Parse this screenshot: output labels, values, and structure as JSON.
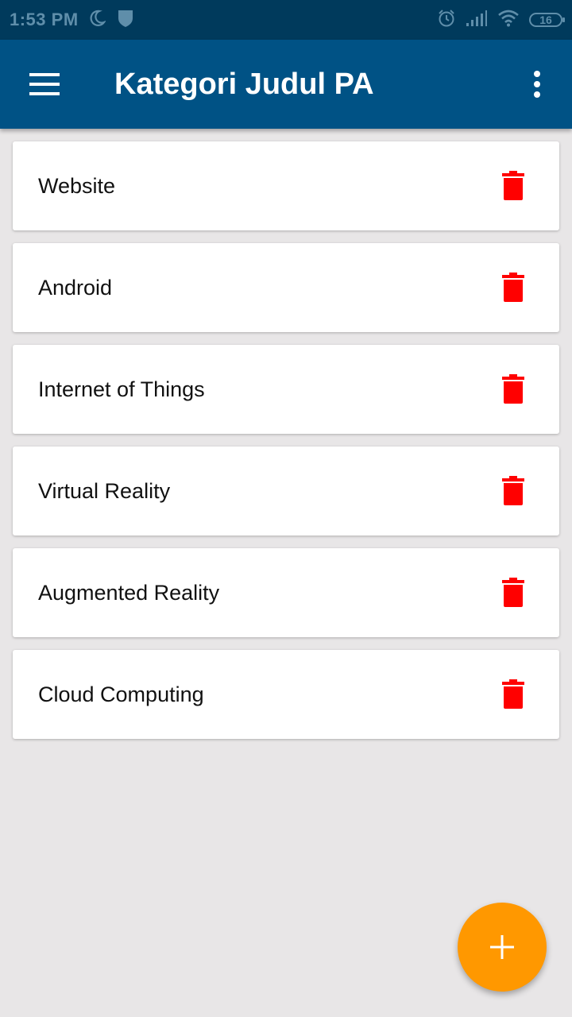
{
  "status_bar": {
    "time": "1:53 PM",
    "battery": "16",
    "icons": [
      "moon-icon",
      "shield-icon",
      "alarm-icon",
      "signal-icon",
      "wifi-icon",
      "battery-icon"
    ]
  },
  "app_bar": {
    "title": "Kategori Judul PA",
    "menu_icon": "hamburger-menu-icon",
    "overflow_icon": "more-vert-icon",
    "background": "#005285"
  },
  "categories": [
    {
      "label": "Website"
    },
    {
      "label": "Android"
    },
    {
      "label": "Internet of Things"
    },
    {
      "label": "Virtual Reality"
    },
    {
      "label": "Augmented Reality"
    },
    {
      "label": "Cloud Computing"
    }
  ],
  "delete_icon": {
    "name": "trash-icon",
    "color": "#ff0000"
  },
  "fab": {
    "icon": "plus-icon",
    "color": "#ff9800"
  }
}
